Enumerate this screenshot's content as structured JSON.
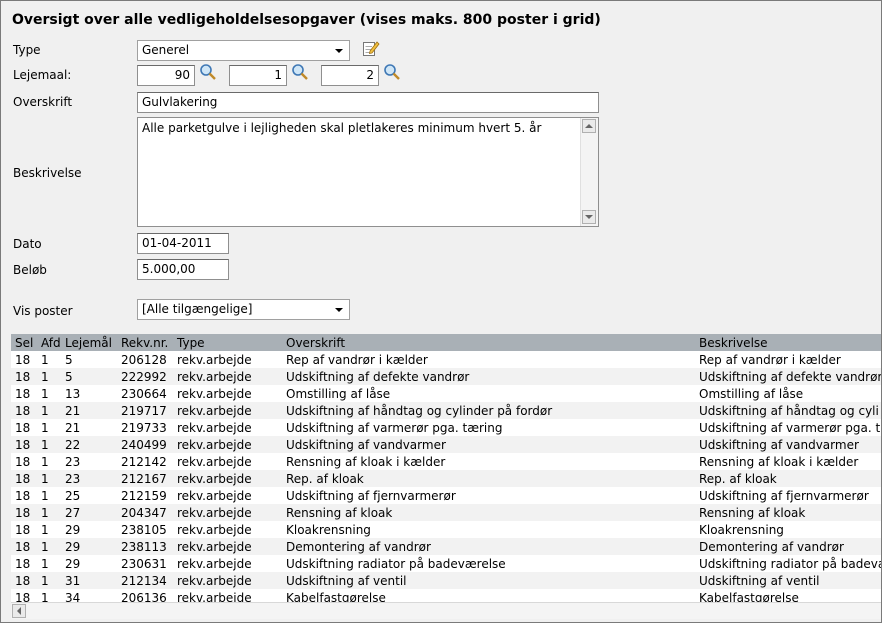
{
  "page": {
    "title": "Oversigt over alle vedligeholdelsesopgaver (vises maks. 800 poster i grid)"
  },
  "form": {
    "type_label": "Type",
    "type_value": "Generel",
    "lejemaal_label": "Lejemaal:",
    "lejemaal_1": "90",
    "lejemaal_2": "1",
    "lejemaal_3": "2",
    "overskrift_label": "Overskrift",
    "overskrift_value": "Gulvlakering",
    "beskrivelse_label": "Beskrivelse",
    "beskrivelse_value": "Alle parketgulve i lejligheden skal pletlakeres minimum hvert 5. år",
    "dato_label": "Dato",
    "dato_value": "01-04-2011",
    "beloeb_label": "Beløb",
    "beloeb_value": "5.000,00",
    "vis_poster_label": "Vis poster",
    "vis_poster_value": "[Alle tilgængelige]"
  },
  "grid": {
    "columns": [
      "Sel",
      "Afd",
      "Lejemål",
      "Rekv.nr.",
      "Type",
      "Overskrift",
      "Beskrivelse"
    ],
    "rows": [
      [
        "18",
        "1",
        "5",
        "206128",
        "rekv.arbejde",
        "Rep af vandrør i kælder",
        "Rep af vandrør i kælder"
      ],
      [
        "18",
        "1",
        "5",
        "222992",
        "rekv.arbejde",
        "Udskiftning af defekte vandrør",
        "Udskiftning af defekte vandrør"
      ],
      [
        "18",
        "1",
        "13",
        "230664",
        "rekv.arbejde",
        "Omstilling af låse",
        "Omstilling af låse"
      ],
      [
        "18",
        "1",
        "21",
        "219717",
        "rekv.arbejde",
        "Udskiftning af håndtag og cylinder på fordør",
        "Udskiftning af håndtag og cyli"
      ],
      [
        "18",
        "1",
        "21",
        "219733",
        "rekv.arbejde",
        "Udskiftning af varmerør pga. tæring",
        "Udskiftning af varmerør pga. t"
      ],
      [
        "18",
        "1",
        "22",
        "240499",
        "rekv.arbejde",
        "Udskiftning af vandvarmer",
        "Udskiftning af vandvarmer"
      ],
      [
        "18",
        "1",
        "23",
        "212142",
        "rekv.arbejde",
        "Rensning af kloak i kælder",
        "Rensning af kloak i kælder"
      ],
      [
        "18",
        "1",
        "23",
        "212167",
        "rekv.arbejde",
        "Rep. af kloak",
        "Rep. af kloak"
      ],
      [
        "18",
        "1",
        "25",
        "212159",
        "rekv.arbejde",
        "Udskiftning af fjernvarmerør",
        "Udskiftning af fjernvarmerør"
      ],
      [
        "18",
        "1",
        "27",
        "204347",
        "rekv.arbejde",
        "Rensning af kloak",
        "Rensning af kloak"
      ],
      [
        "18",
        "1",
        "29",
        "238105",
        "rekv.arbejde",
        "Kloakrensning",
        "Kloakrensning"
      ],
      [
        "18",
        "1",
        "29",
        "238113",
        "rekv.arbejde",
        "Demontering af vandrør",
        "Demontering af vandrør"
      ],
      [
        "18",
        "1",
        "29",
        "230631",
        "rekv.arbejde",
        "Udskiftning radiator på badeværelse",
        "Udskiftning radiator på badevæ"
      ],
      [
        "18",
        "1",
        "31",
        "212134",
        "rekv.arbejde",
        "Udskiftning af ventil",
        "Udskiftning af ventil"
      ],
      [
        "18",
        "1",
        "34",
        "206136",
        "rekv.arbejde",
        "Kabelfastgørelse",
        "Kabelfastgørelse"
      ]
    ]
  },
  "icons": {
    "edit": "edit-note-icon",
    "search": "magnifier-icon"
  },
  "colors": {
    "header_bg": "#a9b0b6",
    "page_bg": "#f0f0f0"
  }
}
